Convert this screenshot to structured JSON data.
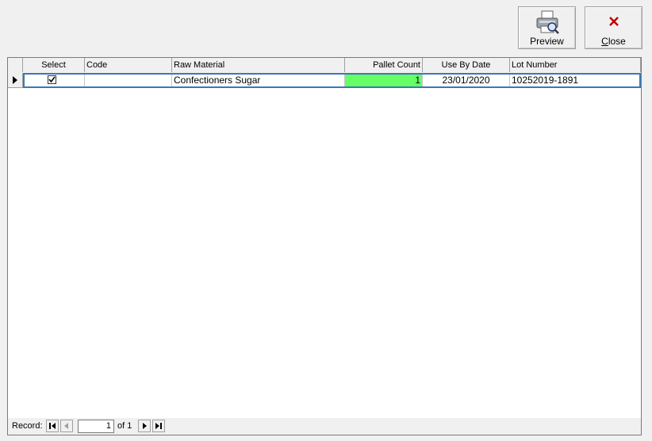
{
  "toolbar": {
    "preview_label": "Preview",
    "close_label": "Close"
  },
  "grid": {
    "columns": [
      "Select",
      "Code",
      "Raw Material",
      "Pallet Count",
      "Use By Date",
      "Lot Number"
    ],
    "rows": [
      {
        "selected": true,
        "code": "",
        "raw_material": "Confectioners Sugar",
        "pallet_count": "1",
        "use_by_date": "23/01/2020",
        "lot_number": "10252019-1891"
      }
    ],
    "highlight_color": "#66ff66"
  },
  "navigator": {
    "record_label": "Record:",
    "current": "1",
    "of_label": "of 1"
  }
}
